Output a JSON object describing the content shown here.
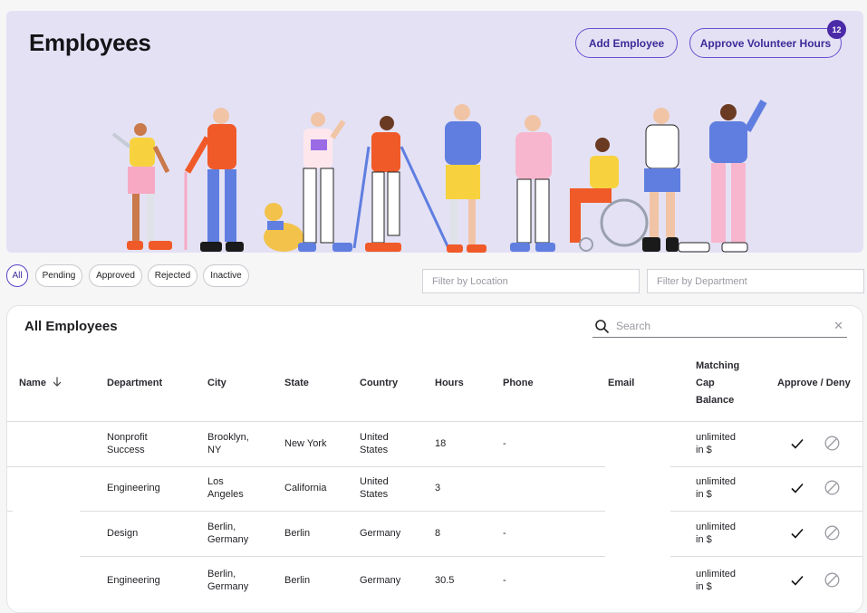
{
  "header": {
    "title": "Employees",
    "add_employee_label": "Add Employee",
    "approve_hours_label": "Approve Volunteer Hours",
    "approve_hours_count": "12"
  },
  "filters": {
    "tabs": [
      {
        "label": "All",
        "active": true
      },
      {
        "label": "Pending",
        "active": false
      },
      {
        "label": "Approved",
        "active": false
      },
      {
        "label": "Rejected",
        "active": false
      },
      {
        "label": "Inactive",
        "active": false
      }
    ],
    "location_placeholder": "Filter by Location",
    "department_placeholder": "Filter by Department"
  },
  "table": {
    "title": "All Employees",
    "search_placeholder": "Search",
    "columns": {
      "name": "Name",
      "department": "Department",
      "city": "City",
      "state": "State",
      "country": "Country",
      "hours": "Hours",
      "phone": "Phone",
      "email": "Email",
      "matching_1": "Matching",
      "matching_2": "Cap",
      "matching_3": "Balance",
      "approve_deny": "Approve / Deny"
    },
    "rows": [
      {
        "department_1": "Nonprofit",
        "department_2": "Success",
        "city_1": "Brooklyn,",
        "city_2": "NY",
        "state": "New York",
        "country_1": "United",
        "country_2": "States",
        "hours": "18",
        "phone": "-",
        "balance_1": "unlimited",
        "balance_2": "in $"
      },
      {
        "department_1": "Engineering",
        "department_2": "",
        "city_1": "Los",
        "city_2": "Angeles",
        "state": "California",
        "country_1": "United",
        "country_2": "States",
        "hours": "3",
        "phone": "",
        "balance_1": "unlimited",
        "balance_2": "in $"
      },
      {
        "department_1": "Design",
        "department_2": "",
        "city_1": "Berlin,",
        "city_2": "Germany",
        "state": "Berlin",
        "country_1": "Germany",
        "country_2": "",
        "hours": "8",
        "phone": "-",
        "balance_1": "unlimited",
        "balance_2": "in $"
      },
      {
        "department_1": "Engineering",
        "department_2": "",
        "city_1": "Berlin,",
        "city_2": "Germany",
        "state": "Berlin",
        "country_1": "Germany",
        "country_2": "",
        "hours": "30.5",
        "phone": "-",
        "balance_1": "unlimited",
        "balance_2": "in $"
      }
    ]
  },
  "colors": {
    "accent": "#5a3fc4",
    "hero_background": "#e4e1f4",
    "badge": "#4b2aa8"
  },
  "icons": [
    "sort-down-arrow-icon",
    "search-icon",
    "clear-x-icon",
    "checkmark-icon",
    "deny-slash-icon"
  ]
}
